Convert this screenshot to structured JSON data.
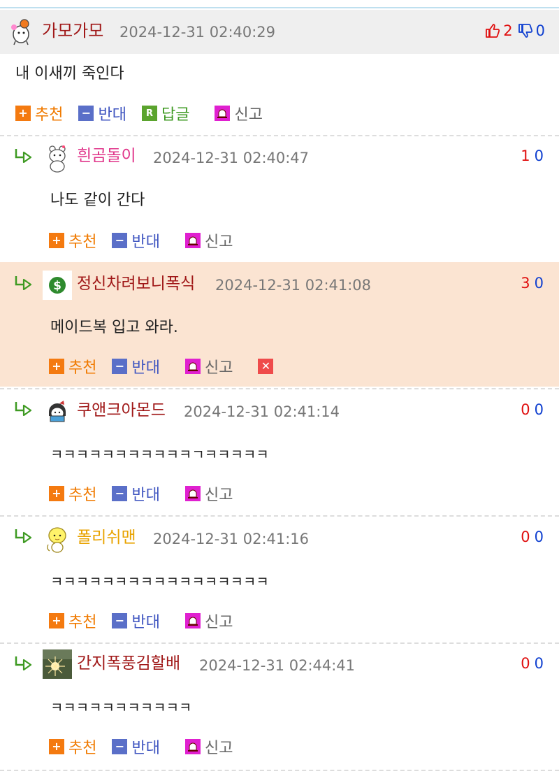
{
  "post": {
    "avatar_icon": "hamster-avatar-icon",
    "nickname": "가모가모",
    "date": "2024-12-31 02:40:29",
    "upvote_icon": "thumbs-up-icon",
    "upvotes": "2",
    "downvote_icon": "thumbs-down-icon",
    "downvotes": "0",
    "body": "내 이새끼 죽인다",
    "actions": {
      "recommend": "추천",
      "oppose": "반대",
      "reply": "답글",
      "report": "신고"
    }
  },
  "comments": [
    {
      "nickname": "흰곰돌이",
      "nick_color": "#e0358a",
      "avatar_icon": "white-bear-avatar-icon",
      "date": "2024-12-31 02:40:47",
      "rec": "1",
      "opp": "0",
      "text": "나도 같이 간다"
    },
    {
      "nickname": "정신차려보니폭식",
      "nick_color": "#a01818",
      "avatar_icon": "dollar-coin-avatar-icon",
      "date": "2024-12-31 02:41:08",
      "rec": "3",
      "opp": "0",
      "text": "메이드복 입고 와라."
    },
    {
      "nickname": "쿠앤크아몬드",
      "nick_color": "#a01818",
      "avatar_icon": "reading-girl-avatar-icon",
      "date": "2024-12-31 02:41:14",
      "rec": "0",
      "opp": "0",
      "text": "ㅋㅋㅋㅋㅋㅋㅋㅋㅋㅋㅋㄱㅋㅋㅋㅋㅋ"
    },
    {
      "nickname": "폴리쉬맨",
      "nick_color": "#e8a300",
      "avatar_icon": "yellow-character-avatar-icon",
      "date": "2024-12-31 02:41:16",
      "rec": "0",
      "opp": "0",
      "text": "ㅋㅋㅋㅋㅋㅋㅋㅋㅋㅋㅋㅋㅋㅋㅋㅋㅋ"
    },
    {
      "nickname": "간지폭풍김할배",
      "nick_color": "#a01818",
      "avatar_icon": "sparkle-photo-avatar-icon",
      "date": "2024-12-31 02:44:41",
      "rec": "0",
      "opp": "0",
      "text": "ㅋㅋㅋㅋㅋㅋㅋㅋㅋㅋㅋ"
    }
  ],
  "comment_actions": {
    "recommend": "추천",
    "oppose": "반대",
    "report": "신고"
  },
  "colors": {
    "highlight_bg": "#fbe4d2",
    "header_bg": "#efefef",
    "recommend": "#f07a00",
    "oppose": "#3f55c0",
    "reply": "#3e9a22"
  }
}
